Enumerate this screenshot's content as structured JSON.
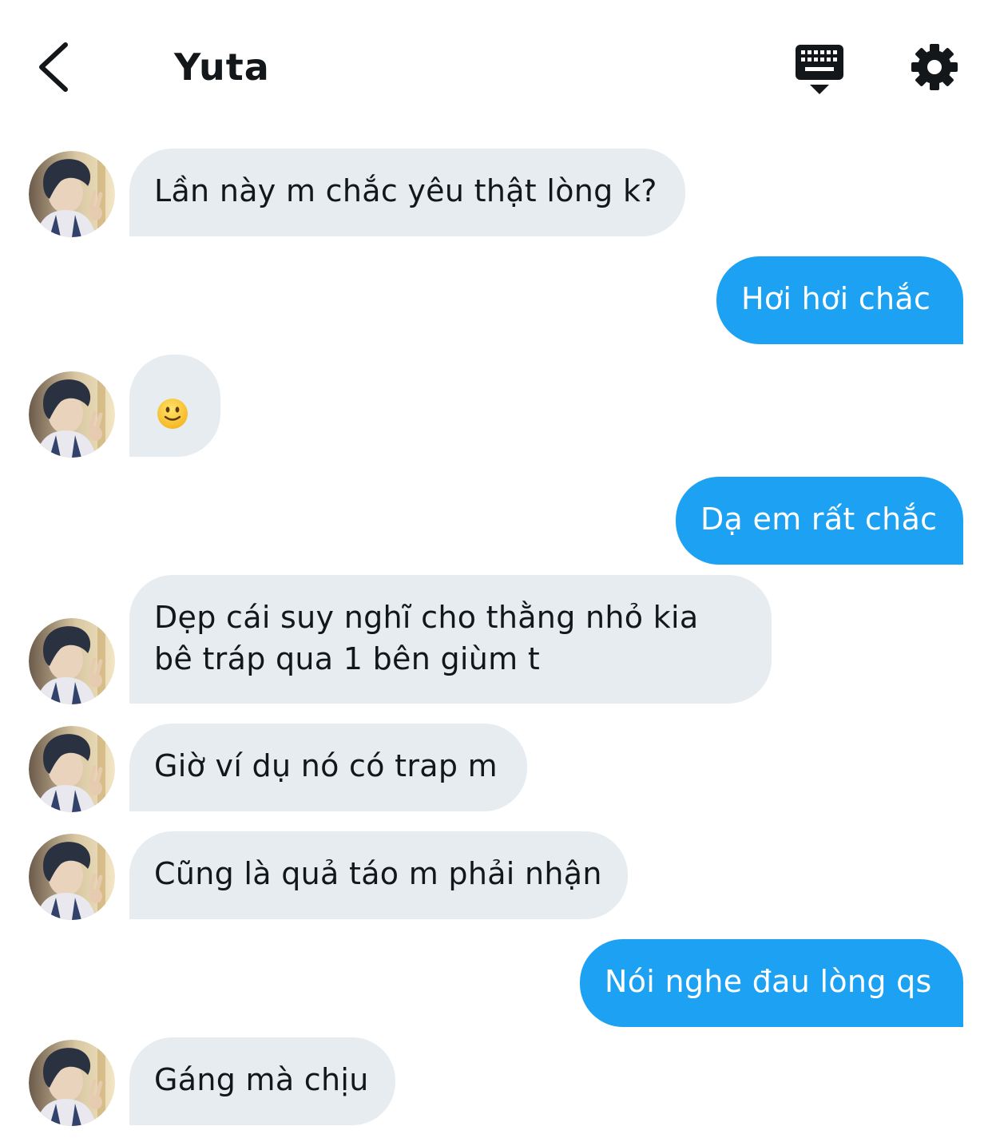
{
  "header": {
    "title": "Yuta",
    "back_icon": "chevron-left-icon",
    "keyboard_icon": "keyboard-icon",
    "settings_icon": "gear-icon"
  },
  "colors": {
    "incoming_bubble": "#e6ecf0",
    "outgoing_bubble": "#1da1f2",
    "text": "#14171a"
  },
  "messages": [
    {
      "sender": "Yuta",
      "direction": "incoming",
      "text": "Lần này m chắc yêu thật lòng k?"
    },
    {
      "sender": "me",
      "direction": "outgoing",
      "text": "Hơi hơi chắc"
    },
    {
      "sender": "Yuta",
      "direction": "incoming",
      "text": "",
      "emoji": "slightly-smiling-face-icon"
    },
    {
      "sender": "me",
      "direction": "outgoing",
      "text": "Dạ em rất chắc"
    },
    {
      "sender": "Yuta",
      "direction": "incoming",
      "lines": [
        "Dẹp cái suy nghĩ cho thằng nhỏ kia",
        "bê tráp qua 1 bên giùm t"
      ]
    },
    {
      "sender": "Yuta",
      "direction": "incoming",
      "text": "Giờ ví dụ nó có trap m"
    },
    {
      "sender": "Yuta",
      "direction": "incoming",
      "text": "Cũng là quả táo m phải nhận"
    },
    {
      "sender": "me",
      "direction": "outgoing",
      "text": "Nói nghe đau lòng qs"
    },
    {
      "sender": "Yuta",
      "direction": "incoming",
      "text": "Gáng mà chịu"
    }
  ]
}
